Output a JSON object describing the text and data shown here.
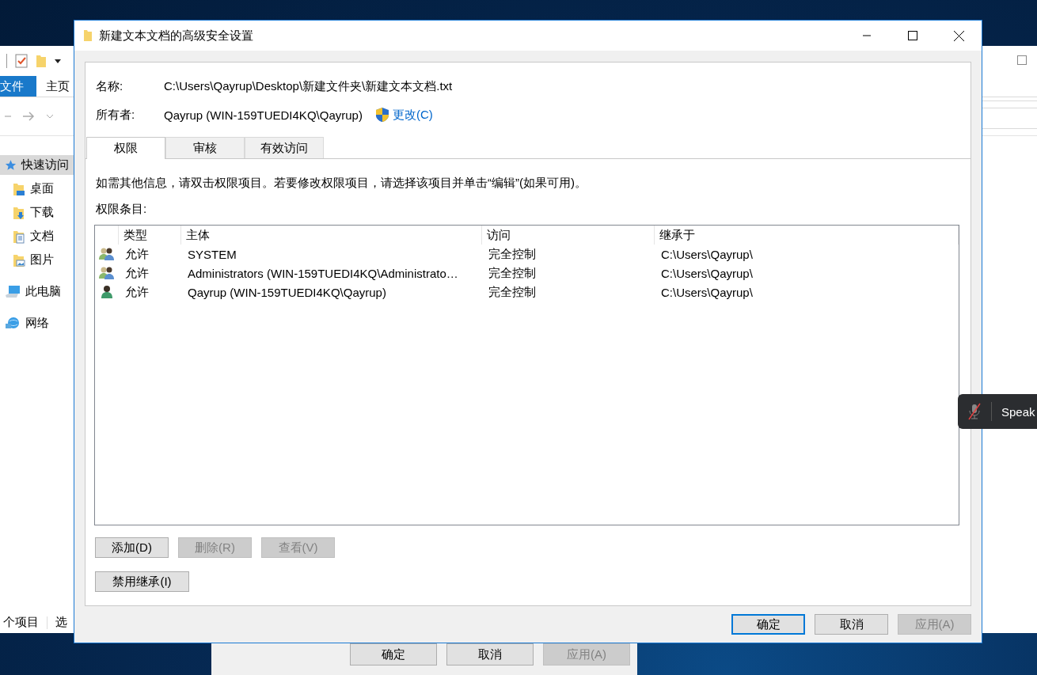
{
  "explorer": {
    "ribbon_tabs": [
      {
        "label": "文件",
        "selected": true
      },
      {
        "label": "主页",
        "selected": false
      }
    ],
    "nav_pane": [
      {
        "kind": "quick_access",
        "label": "快速访问",
        "selected": true,
        "children": [
          {
            "kind": "desktop",
            "label": "桌面",
            "selected": false
          },
          {
            "kind": "downloads",
            "label": "下载",
            "selected": false
          },
          {
            "kind": "documents",
            "label": "文档",
            "selected": false
          },
          {
            "kind": "pictures",
            "label": "图片",
            "selected": false
          }
        ]
      },
      {
        "kind": "this_pc",
        "label": "此电脑",
        "selected": false
      },
      {
        "kind": "network",
        "label": "网络",
        "selected": false
      }
    ],
    "status_bar": [
      "个项目",
      "选"
    ]
  },
  "dialog": {
    "title": "新建文本文档的高级安全设置",
    "name_label": "名称:",
    "name_value": "C:\\Users\\Qayrup\\Desktop\\新建文件夹\\新建文本文档.txt",
    "owner_label": "所有者:",
    "owner_value": "Qayrup (WIN-159TUEDI4KQ\\Qayrup)",
    "change_link": "更改(C)",
    "tabs": [
      {
        "label": "权限",
        "selected": true
      },
      {
        "label": "审核",
        "selected": false
      },
      {
        "label": "有效访问",
        "selected": false
      }
    ],
    "info_text": "如需其他信息，请双击权限项目。若要修改权限项目，请选择该项目并单击“编辑”(如果可用)。",
    "list_label": "权限条目:",
    "table": {
      "columns": [
        "类型",
        "主体",
        "访问",
        "继承于"
      ],
      "rows": [
        {
          "kind": "group",
          "type": "允许",
          "principal": "SYSTEM",
          "access": "完全控制",
          "inherited_from": "C:\\Users\\Qayrup\\"
        },
        {
          "kind": "group",
          "type": "允许",
          "principal": "Administrators (WIN-159TUEDI4KQ\\Administrato…",
          "access": "完全控制",
          "inherited_from": "C:\\Users\\Qayrup\\"
        },
        {
          "kind": "user",
          "type": "允许",
          "principal": "Qayrup (WIN-159TUEDI4KQ\\Qayrup)",
          "access": "完全控制",
          "inherited_from": "C:\\Users\\Qayrup\\"
        }
      ]
    },
    "entry_buttons": [
      {
        "label": "添加(D)",
        "disabled": false
      },
      {
        "label": "删除(R)",
        "disabled": true
      },
      {
        "label": "查看(V)",
        "disabled": true
      }
    ],
    "inheritance_button": {
      "label": "禁用继承(I)",
      "disabled": false
    },
    "footer_buttons": [
      {
        "label": "确定",
        "disabled": false,
        "default": true
      },
      {
        "label": "取消",
        "disabled": false,
        "default": false
      },
      {
        "label": "应用(A)",
        "disabled": true,
        "default": false
      }
    ]
  },
  "back_dialog": {
    "buttons": [
      {
        "label": "确定",
        "disabled": false
      },
      {
        "label": "取消",
        "disabled": false
      },
      {
        "label": "应用(A)",
        "disabled": true
      }
    ]
  },
  "toast": {
    "text": "Speak"
  }
}
